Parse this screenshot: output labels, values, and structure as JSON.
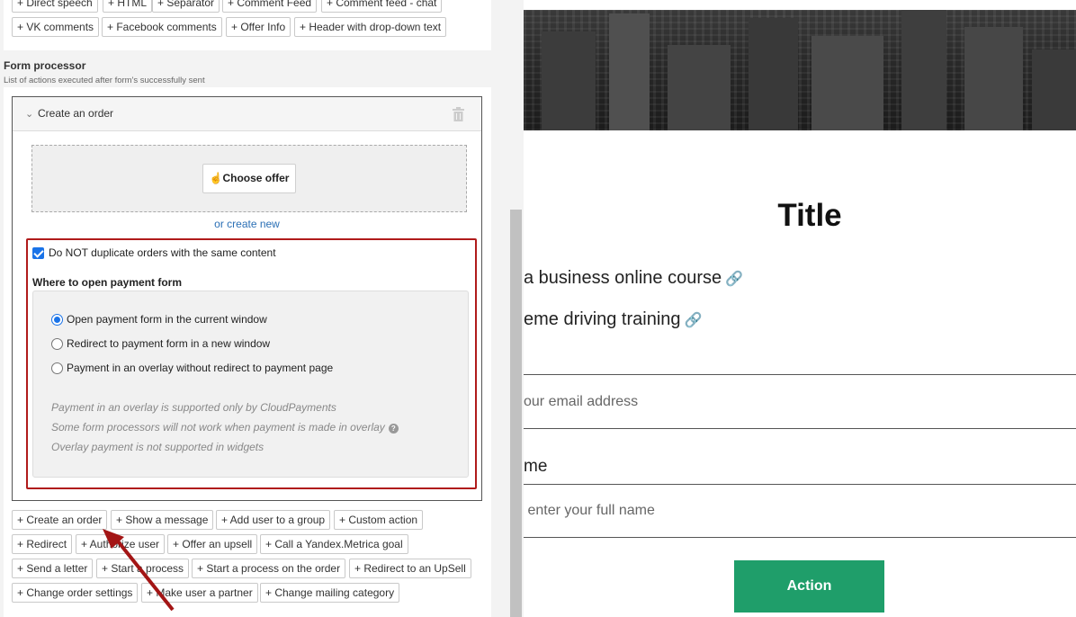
{
  "editor": {
    "top_buttons_row1": [
      "+ Direct speech",
      "+ HTML",
      "+ Separator",
      "+ Comment Feed",
      "+ Comment feed - chat"
    ],
    "top_buttons_row2": [
      "+ VK comments",
      "+ Facebook comments",
      "+ Offer Info",
      "+ Header with drop-down text"
    ],
    "form_processor": {
      "title": "Form processor",
      "description": "List of actions executed after form's successfully sent"
    },
    "order_card": {
      "title": "Create an order",
      "choose_offer": "Choose offer",
      "create_new": "or create new",
      "no_duplicate_label": "Do NOT duplicate orders with the same content",
      "no_duplicate_checked": true,
      "where_label": "Where to open payment form",
      "payment_options": [
        {
          "label": "Open payment form in the current window",
          "selected": true
        },
        {
          "label": "Redirect to payment form in a new window",
          "selected": false
        },
        {
          "label": "Payment in an overlay without redirect to payment page",
          "selected": false
        }
      ],
      "notes": [
        "Payment in an overlay is supported only by CloudPayments",
        "Some form processors will not work when payment is made in overlay",
        "Overlay payment is not supported in widgets"
      ]
    },
    "action_buttons": {
      "row1": [
        "+ Create an order",
        "+ Show a message",
        "+ Add user to a group",
        "+ Custom action"
      ],
      "row2": [
        "+ Redirect",
        "+ Authorize user",
        "+ Offer an upsell",
        "+ Call a Yandex.Metrica goal"
      ],
      "row3": [
        "+ Send a letter",
        "+ Start a process",
        "+ Start a process on the order",
        "+ Redirect to an UpSell"
      ],
      "row4": [
        "+ Change order settings",
        "+ Make user a partner",
        "+ Change mailing category"
      ]
    },
    "highlight_color": "#b01b1b"
  },
  "preview": {
    "title": "Title",
    "courses": [
      "a business online course",
      "eme driving training"
    ],
    "email_placeholder": "our email address",
    "name_label": "me",
    "name_placeholder": " enter your full name",
    "action_label": "Action",
    "action_color": "#1f9e6a"
  }
}
